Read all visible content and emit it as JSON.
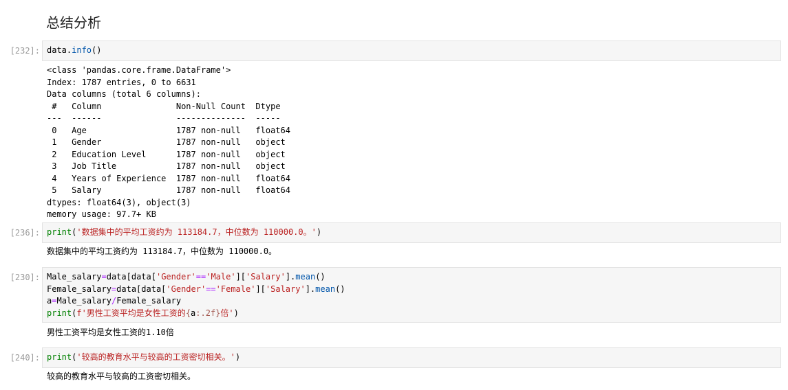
{
  "heading": "总结分析",
  "cells": [
    {
      "prompt": "[232]:",
      "code": {
        "l1": {
          "a": "data.",
          "b": "info",
          "c": "()"
        }
      },
      "output_lines": [
        "<class 'pandas.core.frame.DataFrame'>",
        "Index: 1787 entries, 0 to 6631",
        "Data columns (total 6 columns):",
        " #   Column               Non-Null Count  Dtype  ",
        "---  ------               --------------  -----  ",
        " 0   Age                  1787 non-null   float64",
        " 1   Gender               1787 non-null   object ",
        " 2   Education Level      1787 non-null   object ",
        " 3   Job Title            1787 non-null   object ",
        " 4   Years of Experience  1787 non-null   float64",
        " 5   Salary               1787 non-null   float64",
        "dtypes: float64(3), object(3)",
        "memory usage: 97.7+ KB"
      ]
    },
    {
      "prompt": "[236]:",
      "code": {
        "l1": {
          "fn": "print",
          "open": "(",
          "s": "'数据集中的平均工资约为 113184.7，中位数为 110000.0。'",
          "close": ")"
        }
      },
      "output": "数据集中的平均工资约为 113184.7，中位数为 110000.0。"
    },
    {
      "prompt": "[230]:",
      "code": {
        "l1": {
          "a": "Male_salary",
          "eq": "=",
          "b": "data[data[",
          "s1": "'Gender'",
          "eqeq": "==",
          "s2": "'Male'",
          "c": "][",
          "s3": "'Salary'",
          "d": "].",
          "m": "mean",
          "e": "()"
        },
        "l2": {
          "a": "Female_salary",
          "eq": "=",
          "b": "data[data[",
          "s1": "'Gender'",
          "eqeq": "==",
          "s2": "'Female'",
          "c": "][",
          "s3": "'Salary'",
          "d": "].",
          "m": "mean",
          "e": "()"
        },
        "l3": {
          "a": "a",
          "eq": "=",
          "b": "Male_salary",
          "div": "/",
          "c": "Female_salary"
        },
        "l4": {
          "fn": "print",
          "open": "(",
          "s1": "f'男性工资平均是女性工资的",
          "i1": "{",
          "v": "a",
          "i2": ":.2f}",
          "s2": "倍'",
          "close": ")"
        }
      },
      "output": "男性工资平均是女性工资的1.10倍"
    },
    {
      "prompt": "[240]:",
      "code": {
        "l1": {
          "fn": "print",
          "open": "(",
          "s": "'较高的教育水平与较高的工资密切相关。'",
          "close": ")"
        }
      },
      "output": "较高的教育水平与较高的工资密切相关。"
    }
  ]
}
